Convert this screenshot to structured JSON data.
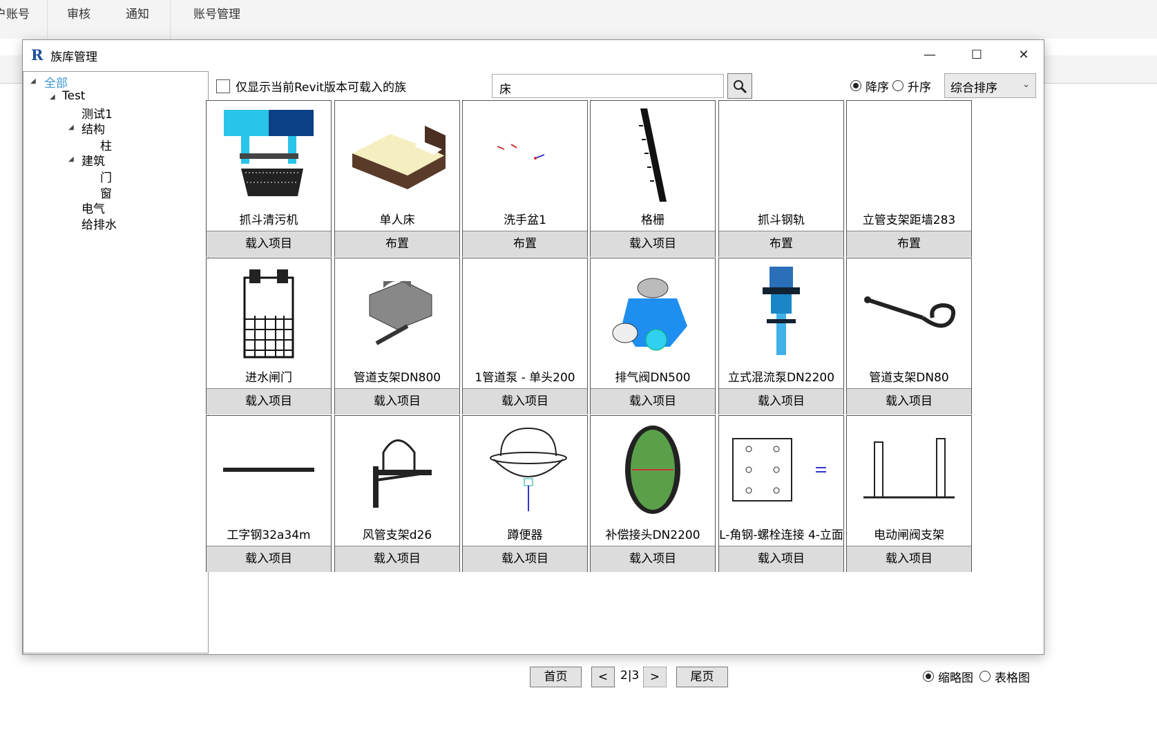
{
  "topbar": {
    "items": [
      "户账号",
      "审核",
      "通知",
      "账号管理"
    ]
  },
  "window": {
    "title": "族库管理",
    "app_icon": "R",
    "controls": {
      "minimize": "—",
      "maximize": "☐",
      "close": "✕"
    }
  },
  "tree": {
    "items": [
      {
        "label": "全部",
        "selected": true
      },
      {
        "label": "Test"
      },
      {
        "label": "测试1"
      },
      {
        "label": "结构"
      },
      {
        "label": "柱"
      },
      {
        "label": "建筑"
      },
      {
        "label": "门"
      },
      {
        "label": "窗"
      },
      {
        "label": "电气"
      },
      {
        "label": "给排水"
      }
    ]
  },
  "filter": {
    "checkbox_label": "仅显示当前Revit版本可载入的族",
    "search_value": "床"
  },
  "sort": {
    "desc_label": "降序",
    "asc_label": "升序",
    "selected_option": "综合排序"
  },
  "cards": [
    {
      "name": "抓斗清污机",
      "action": "载入项目",
      "icon": "grab-bucket-cleaner"
    },
    {
      "name": "单人床",
      "action": "布置",
      "icon": "single-bed"
    },
    {
      "name": "洗手盆1",
      "action": "布置",
      "icon": "washbasin-symbols"
    },
    {
      "name": "格栅",
      "action": "载入项目",
      "icon": "grille-bar"
    },
    {
      "name": "抓斗钢轨",
      "action": "布置",
      "icon": "empty"
    },
    {
      "name": "立管支架距墙283",
      "action": "布置",
      "icon": "empty"
    },
    {
      "name": "进水闸门",
      "action": "载入项目",
      "icon": "inlet-gate"
    },
    {
      "name": "管道支架DN800",
      "action": "载入项目",
      "icon": "pipe-support-saddle"
    },
    {
      "name": "1管道泵 - 单头200",
      "action": "载入项目",
      "icon": "empty"
    },
    {
      "name": "排气阀DN500",
      "action": "载入项目",
      "icon": "air-valve"
    },
    {
      "name": "立式混流泵DN2200",
      "action": "载入项目",
      "icon": "vertical-pump"
    },
    {
      "name": "管道支架DN80",
      "action": "载入项目",
      "icon": "pipe-hook-support"
    },
    {
      "name": "工字钢32a34m",
      "action": "载入项目",
      "icon": "i-beam"
    },
    {
      "name": "风管支架d26",
      "action": "载入项目",
      "icon": "duct-support"
    },
    {
      "name": "蹲便器",
      "action": "载入项目",
      "icon": "squat-toilet"
    },
    {
      "name": "补偿接头DN2200",
      "action": "载入项目",
      "icon": "expansion-joint"
    },
    {
      "name": "L-角钢-螺栓连接 4-立面",
      "action": "载入项目",
      "icon": "angle-bolt-plate"
    },
    {
      "name": "电动闸阀支架",
      "action": "载入项目",
      "icon": "valve-bracket"
    }
  ],
  "pagination": {
    "first": "首页",
    "prev": "<",
    "page_text": "2|3",
    "next": ">",
    "last": "尾页"
  },
  "view": {
    "thumb_label": "缩略图",
    "table_label": "表格图",
    "selected": "thumbnail"
  }
}
